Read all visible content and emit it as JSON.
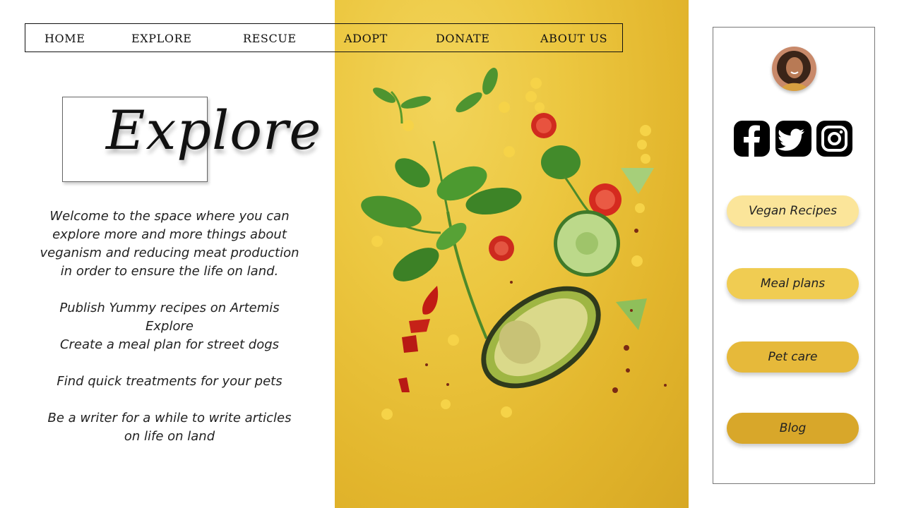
{
  "nav": {
    "items": [
      "HOME",
      "EXPLORE",
      "RESCUE",
      "ADOPT",
      "DONATE",
      "ABOUT US"
    ]
  },
  "page": {
    "title": "Explore",
    "intro": "Welcome to the space where you can explore more and more things about veganism and reducing meat production in order to ensure the life on land.",
    "items": [
      "Publish Yummy recipes on Artemis Explore",
      "Create a meal plan for street dogs",
      "Find quick treatments for your pets",
      "Be a writer for a while to write articles on life on land"
    ]
  },
  "sidebar": {
    "social": [
      "facebook-icon",
      "twitter-icon",
      "instagram-icon"
    ],
    "buttons": [
      {
        "label": "Vegan Recipes",
        "color": "#fbe59a"
      },
      {
        "label": "Meal plans",
        "color": "#f0cc52"
      },
      {
        "label": "Pet care",
        "color": "#e6b93a"
      },
      {
        "label": "Blog",
        "color": "#d8a72a"
      }
    ]
  },
  "colors": {
    "hero": "#e8bd34",
    "text": "#222222"
  }
}
